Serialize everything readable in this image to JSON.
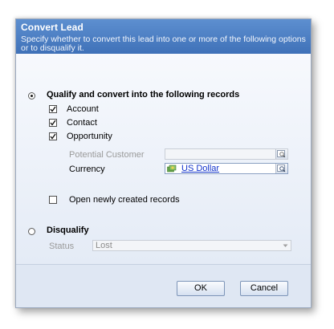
{
  "dialog": {
    "title": "Convert Lead",
    "description": "Specify whether to convert this lead into one or more of the following options or to disqualify it."
  },
  "qualify": {
    "label": "Qualify and convert into the following records",
    "selected": true,
    "options": [
      {
        "label": "Account",
        "checked": true
      },
      {
        "label": "Contact",
        "checked": true
      },
      {
        "label": "Opportunity",
        "checked": true
      }
    ],
    "potential_customer": {
      "label": "Potential Customer",
      "value": ""
    },
    "currency": {
      "label": "Currency",
      "value": "US Dollar"
    },
    "open_records": {
      "label": "Open newly created records",
      "checked": false
    }
  },
  "disqualify": {
    "label": "Disqualify",
    "selected": false,
    "status_label": "Status",
    "status_value": "Lost"
  },
  "footer": {
    "ok_label": "OK",
    "cancel_label": "Cancel"
  },
  "icons": {
    "lookup": "magnifier-lookup-icon",
    "currency": "currency-icon",
    "dropdown": "chevron-down-icon"
  },
  "colors": {
    "header": "#4a7ec4",
    "body": "#e8eef8",
    "link": "#1133cc"
  }
}
